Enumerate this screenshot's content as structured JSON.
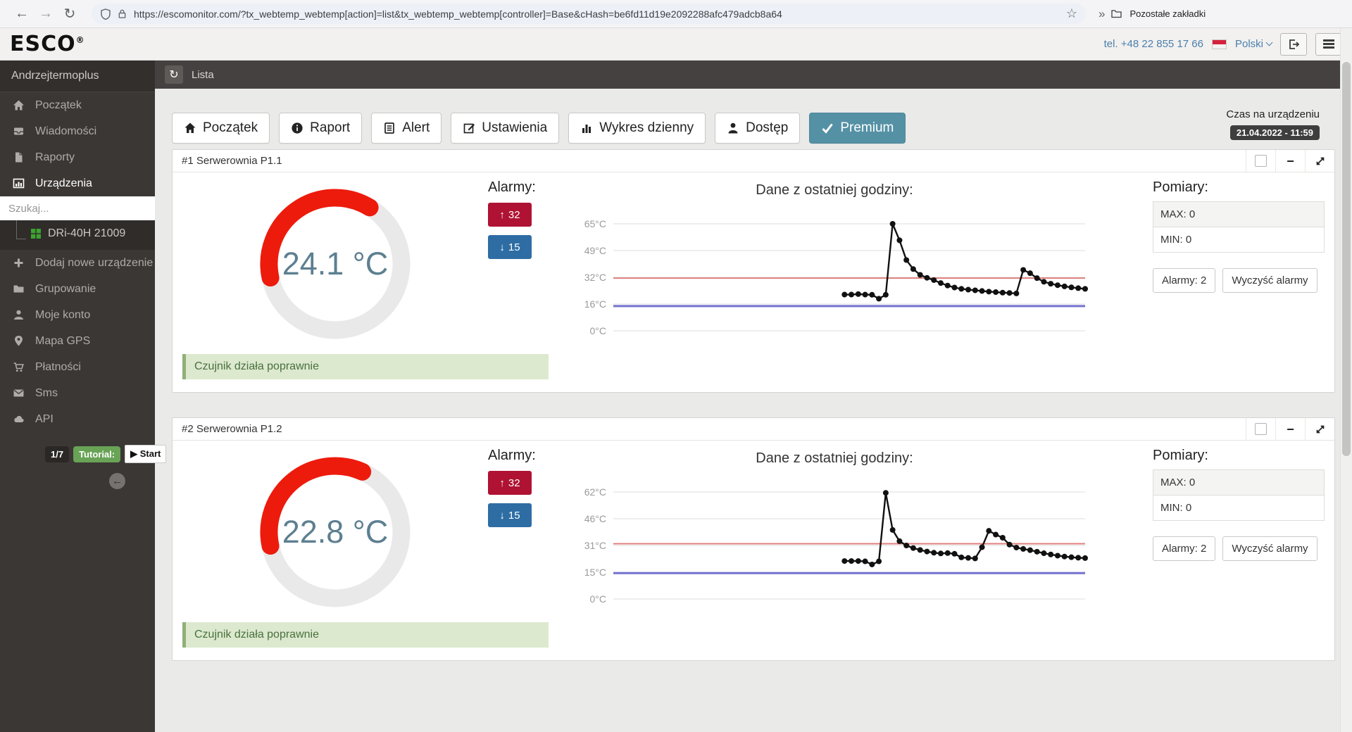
{
  "browser": {
    "url": "https://escomonitor.com/?tx_webtemp_webtemp[action]=list&tx_webtemp_webtemp[controller]=Base&cHash=be6fd11d19e2092288afc479adcb8a64",
    "bookmarks_label": "Pozostałe zakładki",
    "back": "←",
    "forward": "→",
    "reload": "↻",
    "star": "☆",
    "more": "»"
  },
  "header": {
    "logo": "ESCO",
    "logo_reg": "®",
    "phone": "tel. +48 22 855 17 66",
    "language": "Polski"
  },
  "sidebar": {
    "account": "Andrzejtermoplus",
    "items": [
      {
        "label": "Początek"
      },
      {
        "label": "Wiadomości"
      },
      {
        "label": "Raporty"
      },
      {
        "label": "Urządzenia"
      }
    ],
    "search_placeholder": "Szukaj...",
    "device": "DRi-40H 21009",
    "items2": [
      {
        "label": "Dodaj nowe urządzenie"
      },
      {
        "label": "Grupowanie"
      },
      {
        "label": "Moje konto"
      },
      {
        "label": "Mapa GPS"
      },
      {
        "label": "Płatności"
      },
      {
        "label": "Sms"
      },
      {
        "label": "API"
      }
    ],
    "tutorial": {
      "step": "1/7",
      "label": "Tutorial:",
      "play": "▶",
      "start_label": "Start",
      "back_arrow": "←"
    }
  },
  "toolbar": {
    "refresh": "↻",
    "breadcrumb": "Lista"
  },
  "tabs": [
    {
      "label": "Początek"
    },
    {
      "label": "Raport"
    },
    {
      "label": "Alert"
    },
    {
      "label": "Ustawienia"
    },
    {
      "label": "Wykres dzienny"
    },
    {
      "label": "Dostęp"
    },
    {
      "label": "Premium",
      "active": true
    }
  ],
  "clock": {
    "label": "Czas na urządzeniu",
    "value": "21.04.2022 - 11:59"
  },
  "panels": [
    {
      "title": "#1 Serwerownia P1.1",
      "temperature": "24.1 °C",
      "temp_value": 24.1,
      "collapse": "−",
      "alarms_label": "Alarmy:",
      "alarm_up_arrow": "↑",
      "alarm_high": "32",
      "alarm_down_arrow": "↓",
      "alarm_low": "15",
      "status": "Czujnik działa poprawnie",
      "measurements_label": "Pomiary:",
      "max_label": "MAX: 0",
      "min_label": "MIN: 0",
      "alarm_count_btn": "Alarmy: 2",
      "clear_btn": "Wyczyść alarmy"
    },
    {
      "title": "#2 Serwerownia P1.2",
      "temperature": "22.8 °C",
      "temp_value": 22.8,
      "collapse": "−",
      "alarms_label": "Alarmy:",
      "alarm_up_arrow": "↑",
      "alarm_high": "32",
      "alarm_down_arrow": "↓",
      "alarm_low": "15",
      "status": "Czujnik działa poprawnie",
      "measurements_label": "Pomiary:",
      "max_label": "MAX: 0",
      "min_label": "MIN: 0",
      "alarm_count_btn": "Alarmy: 2",
      "clear_btn": "Wyczyść alarmy"
    }
  ],
  "gauge": {
    "max": 65,
    "start_angle_deg": 258,
    "ring_color": "#E9E9E9",
    "arc_color": "#ED1B0C",
    "value_color": "#5D7F91"
  },
  "chart_data": [
    {
      "type": "line",
      "title": "Dane z ostatniej godziny:",
      "ytick_labels": [
        "65°C",
        "49°C",
        "32°C",
        "16°C",
        "0°C"
      ],
      "ylim": [
        0,
        65
      ],
      "alarm_line_high": 32,
      "alarm_line_low": 15,
      "x_start_frac": 0.49,
      "grid": true,
      "legend": false,
      "colors": {
        "series": "#111111",
        "alarm_high": "#E0807D",
        "alarm_low": "#7472CF",
        "grid": "#DCDCDC"
      },
      "values": [
        22,
        22,
        22.3,
        22,
        21.9,
        19.5,
        21.9,
        65,
        55,
        43,
        37.5,
        34,
        32.2,
        30.8,
        29,
        27.5,
        26.3,
        25.5,
        25,
        24.6,
        24.2,
        23.8,
        23.5,
        23.2,
        23,
        22.7,
        37,
        35,
        32,
        29.8,
        28.6,
        27.7,
        27,
        26.4,
        25.9,
        25.5
      ]
    },
    {
      "type": "line",
      "title": "Dane z ostatniej godziny:",
      "ytick_labels": [
        "62°C",
        "46°C",
        "31°C",
        "15°C",
        "0°C"
      ],
      "ylim": [
        0,
        62
      ],
      "alarm_line_high": 32,
      "alarm_line_low": 15,
      "x_start_frac": 0.49,
      "grid": true,
      "legend": false,
      "colors": {
        "series": "#111111",
        "alarm_high": "#E0807D",
        "alarm_low": "#7472CF",
        "grid": "#DCDCDC"
      },
      "values": [
        22,
        22,
        22,
        21.8,
        20,
        21.8,
        61.5,
        40,
        33.5,
        31,
        29.5,
        28.4,
        27.5,
        26.8,
        26.4,
        26.6,
        26.2,
        24.1,
        23.8,
        23.5,
        30,
        39.5,
        37.3,
        35.5,
        31.5,
        29.8,
        29,
        28.3,
        27.4,
        26.5,
        25.8,
        25.1,
        24.6,
        24.2,
        23.9,
        23.7
      ]
    }
  ]
}
